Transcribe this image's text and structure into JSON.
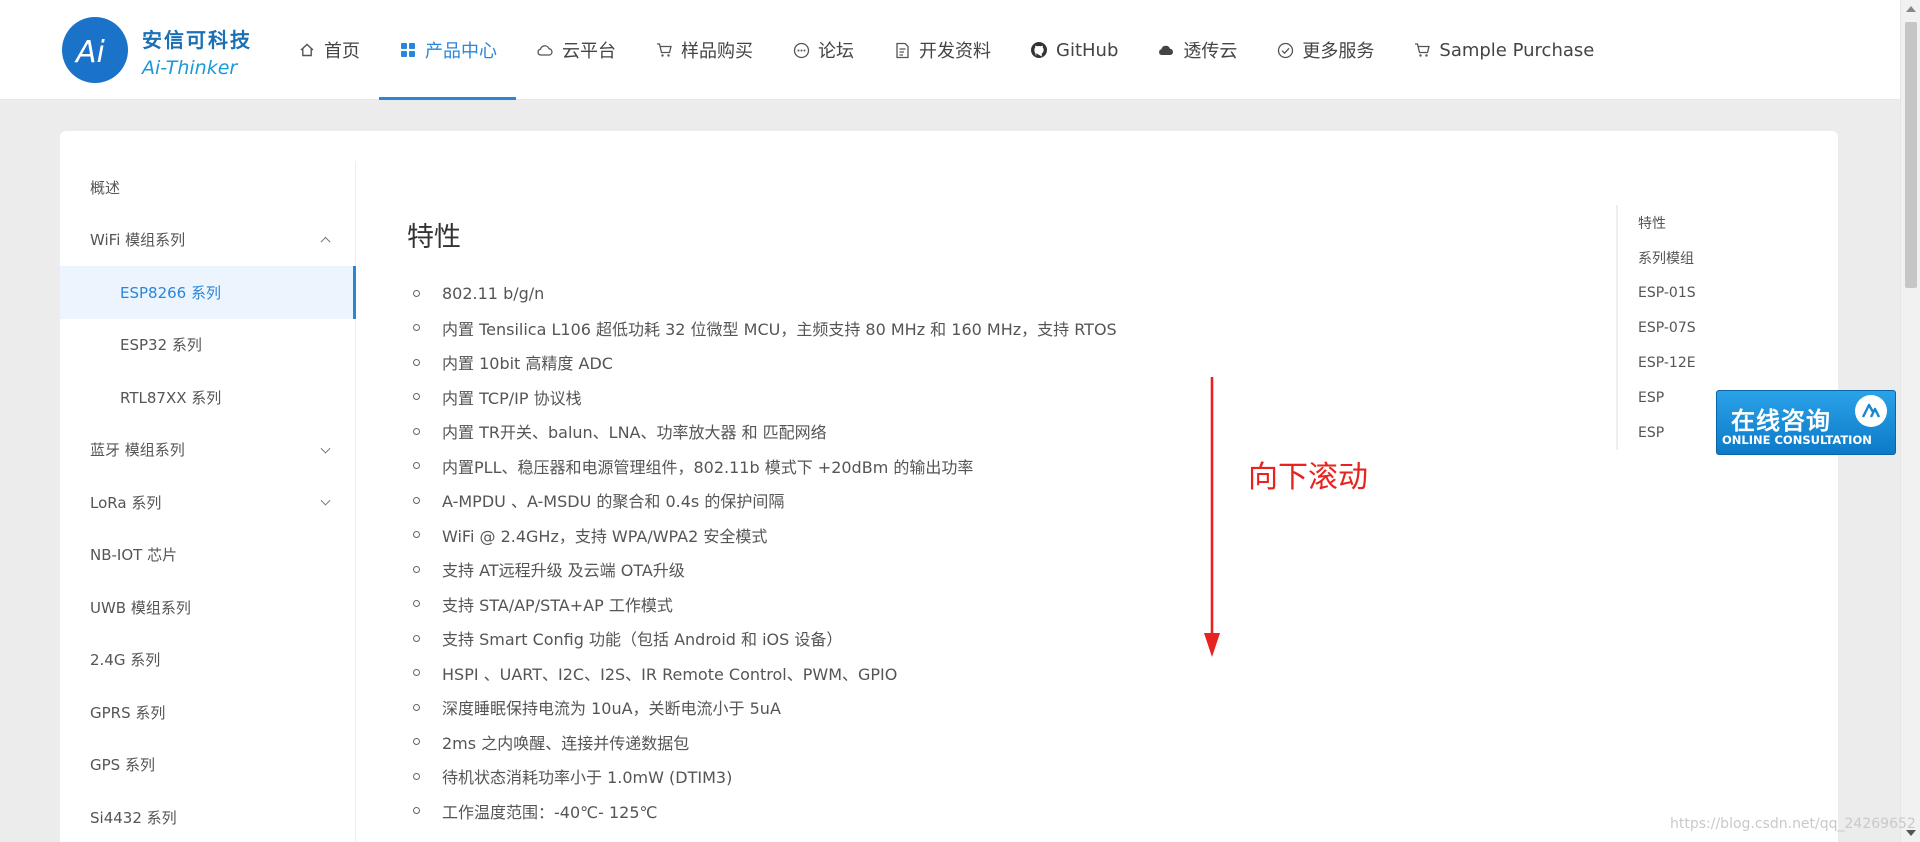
{
  "brand": {
    "logo_letters": "Ai",
    "name_cn": "安信可科技",
    "name_en": "Ai-Thinker"
  },
  "nav": [
    {
      "label": "首页",
      "icon": "home-icon"
    },
    {
      "label": "产品中心",
      "icon": "grid-icon",
      "active": true
    },
    {
      "label": "云平台",
      "icon": "cloud-outline-icon"
    },
    {
      "label": "样品购买",
      "icon": "cart-icon"
    },
    {
      "label": "论坛",
      "icon": "chat-icon"
    },
    {
      "label": "开发资料",
      "icon": "document-icon"
    },
    {
      "label": "GitHub",
      "icon": "github-icon"
    },
    {
      "label": "透传云",
      "icon": "cloud-filled-icon"
    },
    {
      "label": "更多服务",
      "icon": "check-circle-icon"
    },
    {
      "label": "Sample Purchase",
      "icon": "cart-icon"
    }
  ],
  "sidebar": {
    "items": [
      {
        "label": "概述"
      },
      {
        "label": "WiFi 模组系列",
        "expanded": true
      },
      {
        "label": "ESP8266 系列",
        "sub": true,
        "active": true
      },
      {
        "label": "ESP32 系列",
        "sub": true
      },
      {
        "label": "RTL87XX 系列",
        "sub": true
      },
      {
        "label": "蓝牙 模组系列",
        "collapsible": true
      },
      {
        "label": "LoRa 系列",
        "collapsible": true
      },
      {
        "label": "NB-IOT 芯片"
      },
      {
        "label": "UWB 模组系列"
      },
      {
        "label": "2.4G 系列"
      },
      {
        "label": "GPRS 系列"
      },
      {
        "label": "GPS 系列"
      },
      {
        "label": "Si4432 系列"
      }
    ]
  },
  "main": {
    "title": "特性",
    "features": [
      "802.11 b/g/n",
      "内置 Tensilica L106 超低功耗 32 位微型 MCU，主频支持 80 MHz 和 160 MHz，支持 RTOS",
      "内置 10bit 高精度 ADC",
      "内置 TCP/IP 协议栈",
      "内置 TR开关、balun、LNA、功率放大器 和 匹配网络",
      "内置PLL、稳压器和电源管理组件，802.11b 模式下 +20dBm 的输出功率",
      "A-MPDU 、A-MSDU 的聚合和 0.4s 的保护间隔",
      "WiFi @ 2.4GHz，支持 WPA/WPA2 安全模式",
      "支持 AT远程升级 及云端 OTA升级",
      "支持 STA/AP/STA+AP 工作模式",
      "支持 Smart Config 功能（包括 Android 和 iOS 设备）",
      "HSPI 、UART、I2C、I2S、IR Remote Control、PWM、GPIO",
      "深度睡眠保持电流为 10uA，关断电流小于 5uA",
      "2ms 之内唤醒、连接并传递数据包",
      "待机状态消耗功率小于 1.0mW (DTIM3)",
      "工作温度范围：-40℃- 125℃"
    ]
  },
  "toc": [
    "特性",
    "系列模组",
    "ESP-01S",
    "ESP-07S",
    "ESP-12E",
    "ESP",
    "ESP"
  ],
  "consult": {
    "label_cn": "在线咨询",
    "label_en": "ONLINE CONSULTATION"
  },
  "annotation": {
    "scroll_note": "向下滚动",
    "color": "#e8231f"
  },
  "watermark": "https://blog.csdn.net/qq_24269652",
  "colors": {
    "accent": "#2b86d9",
    "brand": "#1a73c8"
  }
}
